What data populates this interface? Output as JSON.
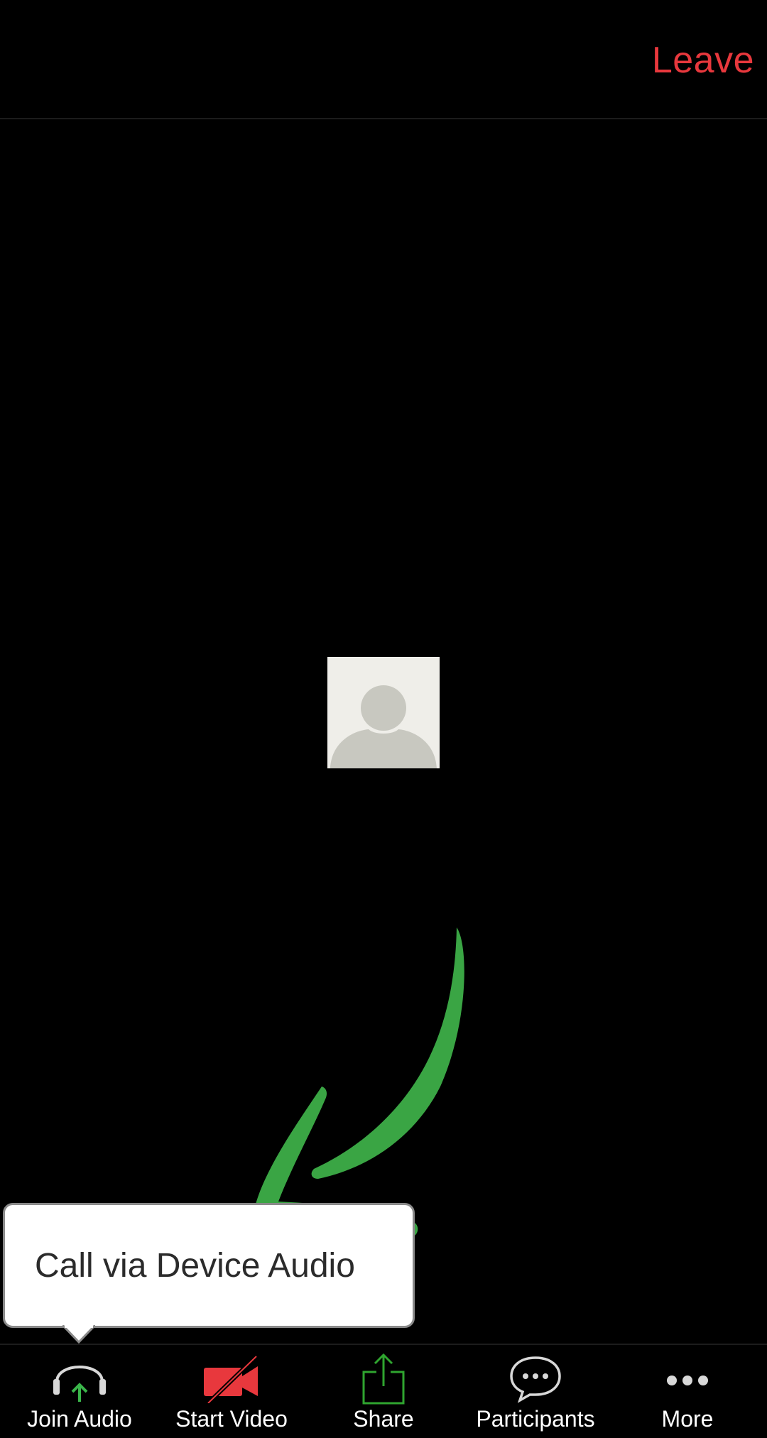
{
  "header": {
    "leave_label": "Leave"
  },
  "tooltip": {
    "text": "Call via Device Audio"
  },
  "toolbar": {
    "items": [
      {
        "label": "Join Audio",
        "icon": "headphones-icon"
      },
      {
        "label": "Start Video",
        "icon": "video-off-icon"
      },
      {
        "label": "Share",
        "icon": "share-icon"
      },
      {
        "label": "Participants",
        "icon": "chat-bubble-icon"
      },
      {
        "label": "More",
        "icon": "more-dots-icon"
      }
    ]
  },
  "colors": {
    "leave": "#e8383d",
    "video_off": "#e8383d",
    "share": "#2fa52f",
    "arrow": "#3aa544",
    "background": "#000000"
  }
}
